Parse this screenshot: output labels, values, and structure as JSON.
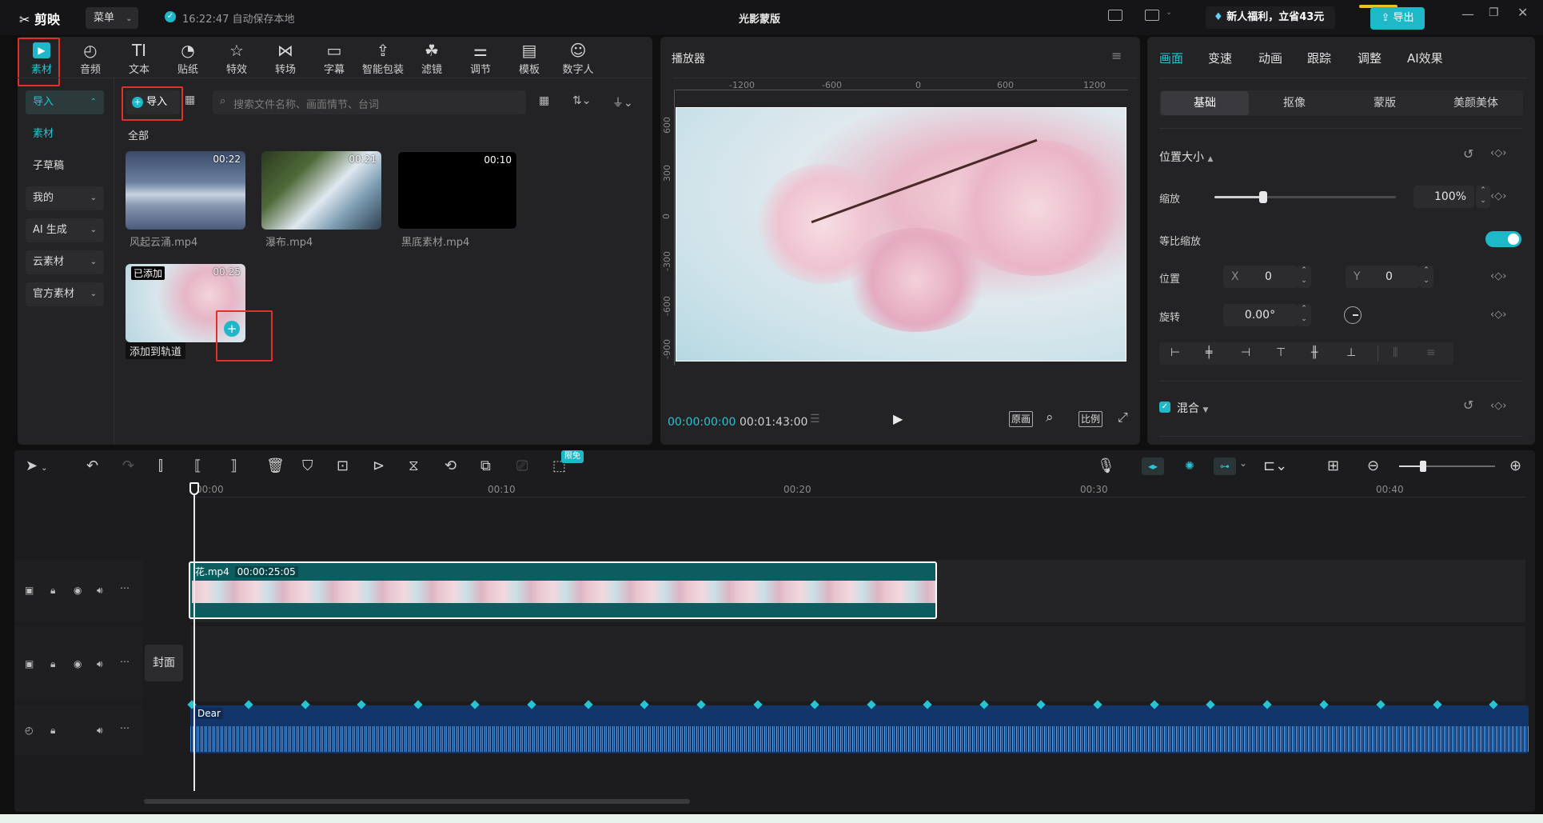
{
  "app": {
    "logo": "剪映",
    "menu_label": "菜单",
    "autosave": "16:22:47 自动保存本地",
    "project_title": "光影蒙版",
    "promo": "新人福利，立省43元",
    "export_label": "导出"
  },
  "toolbar": {
    "items": [
      {
        "label": "素材",
        "icon": "media-icon"
      },
      {
        "label": "音频",
        "icon": "audio-icon"
      },
      {
        "label": "文本",
        "icon": "text-icon"
      },
      {
        "label": "贴纸",
        "icon": "sticker-icon"
      },
      {
        "label": "特效",
        "icon": "effects-icon"
      },
      {
        "label": "转场",
        "icon": "transition-icon"
      },
      {
        "label": "字幕",
        "icon": "subtitle-icon"
      },
      {
        "label": "智能包装",
        "icon": "smart-pack-icon"
      },
      {
        "label": "滤镜",
        "icon": "filter-icon"
      },
      {
        "label": "调节",
        "icon": "adjust-icon"
      },
      {
        "label": "模板",
        "icon": "template-icon"
      },
      {
        "label": "数字人",
        "icon": "avatar-icon"
      }
    ]
  },
  "sidebar": {
    "items": [
      {
        "label": "导入"
      },
      {
        "label": "素材"
      },
      {
        "label": "子草稿"
      },
      {
        "label": "我的"
      },
      {
        "label": "AI 生成"
      },
      {
        "label": "云素材"
      },
      {
        "label": "官方素材"
      }
    ]
  },
  "media": {
    "import_label": "导入",
    "search_placeholder": "搜索文件名称、画面情节、台词",
    "section_all": "全部",
    "clips": [
      {
        "name": "风起云涌.mp4",
        "duration": "00:22"
      },
      {
        "name": "瀑布.mp4",
        "duration": "00:21"
      },
      {
        "name": "黑底素材.mp4",
        "duration": "00:10"
      },
      {
        "name": "添加到轨道",
        "duration": "00:25",
        "badge": "已添加"
      }
    ]
  },
  "player": {
    "title": "播放器",
    "ruler_h": [
      "-1200",
      "-600",
      "0",
      "600",
      "1200"
    ],
    "ruler_v": [
      "600",
      "300",
      "0",
      "-300",
      "-600",
      "-900"
    ],
    "current_time": "00:00:00:00",
    "total_time": "00:01:43:00",
    "btn_original": "原画",
    "btn_ratio": "比例"
  },
  "props": {
    "tabs": [
      "画面",
      "变速",
      "动画",
      "跟踪",
      "调整",
      "AI效果"
    ],
    "subtabs": [
      "基础",
      "抠像",
      "蒙版",
      "美颜美体"
    ],
    "section_position": "位置大小",
    "scale_label": "缩放",
    "scale_value": "100%",
    "scale_level": 0.27,
    "uniform_label": "等比缩放",
    "position_label": "位置",
    "x_label": "X",
    "x_value": "0",
    "y_label": "Y",
    "y_value": "0",
    "rotate_label": "旋转",
    "rotate_value": "0.00°",
    "blend_label": "混合"
  },
  "timeline": {
    "free_badge": "限免",
    "ruler": [
      "00:00",
      "00:10",
      "00:20",
      "00:30",
      "00:40"
    ],
    "video_clip_name": "花.mp4",
    "video_clip_duration": "00:00:25:05",
    "cover_label": "封面",
    "audio_clip_name": "Dear",
    "zoom_level": 0.25
  },
  "colors": {
    "accent": "#1fb8c8",
    "highlight_box": "#e0302a",
    "video_track": "#0d5c60",
    "audio_track": "#13366a"
  }
}
